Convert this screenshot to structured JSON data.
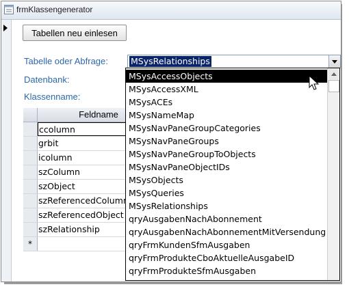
{
  "window": {
    "title": "frmKlassengenerator"
  },
  "form": {
    "reload_button": "Tabellen neu einlesen",
    "table_label": "Tabelle oder Abfrage:",
    "table_value": "MSysRelationships",
    "database_label": "Datenbank:",
    "classname_label": "Klassenname:"
  },
  "grid": {
    "header": "Feldname",
    "rows": [
      "ccolumn",
      "grbit",
      "icolumn",
      "szColumn",
      "szObject",
      "szReferencedColumn",
      "szReferencedObject",
      "szRelationship"
    ],
    "new_row_marker": "*"
  },
  "dropdown": {
    "options": [
      "MSysAccessObjects",
      "MSysAccessXML",
      "MSysACEs",
      "MSysNameMap",
      "MSysNavPaneGroupCategories",
      "MSysNavPaneGroups",
      "MSysNavPaneGroupToObjects",
      "MSysNavPaneObjectIDs",
      "MSysObjects",
      "MSysQueries",
      "MSysRelationships",
      "qryAusgabenNachAbonnement",
      "qryAusgabenNachAbonnementMitVersendung",
      "qryFrmKundenSfmAusgaben",
      "qryFrmProdukteCboAktuelleAusgabeID",
      "qryFrmProdukteSfmAusgaben"
    ],
    "highlighted_index": 0
  },
  "colors": {
    "label_blue": "#2e68a8",
    "selection": "#0a246a"
  }
}
